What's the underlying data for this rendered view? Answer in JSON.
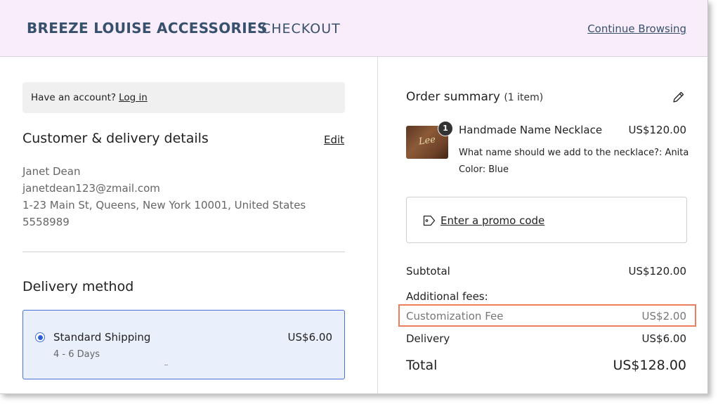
{
  "header": {
    "brand": "BREEZE LOUISE ACCESSORIES",
    "subtitle": "CHECKOUT",
    "continue_link": "Continue Browsing"
  },
  "account": {
    "prompt": "Have an account?",
    "login_link": "Log in"
  },
  "customer": {
    "title": "Customer & delivery details",
    "edit_link": "Edit",
    "name": "Janet Dean",
    "email": "janetdean123@zmail.com",
    "address": "1-23 Main St, Queens, New York 10001, United States",
    "phone": "5558989"
  },
  "delivery": {
    "title": "Delivery method",
    "option_name": "Standard Shipping",
    "option_days": "4 - 6 Days",
    "option_price": "US$6.00",
    "selected": true
  },
  "summary": {
    "title": "Order summary",
    "count": "(1 item)",
    "item": {
      "quantity_badge": "1",
      "thumb_script": "Lee",
      "name": "Handmade Name Necklace",
      "price": "US$120.00",
      "option_1": "What name should we add to the necklace?: Anita",
      "option_2": "Color: Blue"
    },
    "promo_link": "Enter a promo code",
    "subtotal_label": "Subtotal",
    "subtotal_value": "US$120.00",
    "fees_label": "Additional fees:",
    "fee_name": "Customization Fee",
    "fee_value": "US$2.00",
    "delivery_label": "Delivery",
    "delivery_value": "US$6.00",
    "total_label": "Total",
    "total_value": "US$128.00"
  },
  "colors": {
    "header_bg": "#f9ecfb",
    "brand": "#37516d",
    "selected_bg": "#e9f0fb",
    "selected_border": "#4a6fd8",
    "highlight": "#ee7d5f"
  },
  "icons": {
    "edit": "pencil-icon",
    "promo": "tag-icon",
    "radio": "radio-selected-icon"
  }
}
